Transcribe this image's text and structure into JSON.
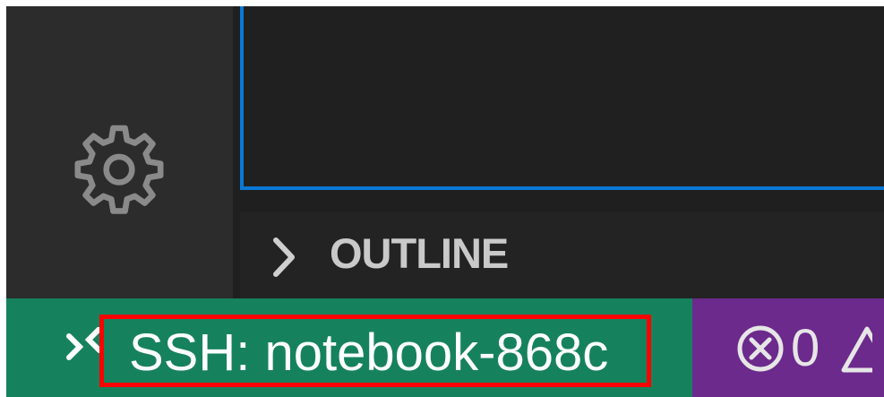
{
  "activity_bar": {
    "manage_icon": "gear-icon"
  },
  "sidebar": {
    "outline": {
      "chevron_icon": "chevron-right-icon",
      "title": "OUTLINE"
    }
  },
  "status_bar": {
    "remote": {
      "icon": "remote-icon",
      "label": "SSH: notebook-868c"
    },
    "problems": {
      "error_icon": "error-icon",
      "errors": "0",
      "warning_icon": "warning-icon"
    }
  },
  "colors": {
    "accent_focus_border": "#0a78d4",
    "remote_background": "#16825d",
    "problems_background": "#6c2a8c",
    "highlight_box": "#ff0000"
  }
}
